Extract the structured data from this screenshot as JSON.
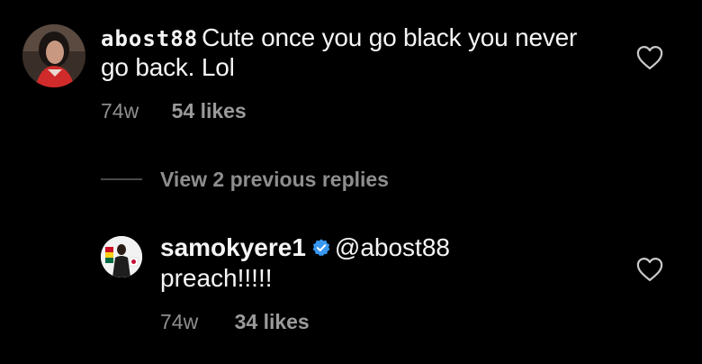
{
  "comment": {
    "username": "abost88",
    "text": "Cute once you go black you never go back. Lol",
    "time": "74w",
    "likes": "54 likes",
    "like_icon": "heart-outline-icon"
  },
  "view_replies": {
    "label": "View 2 previous replies"
  },
  "reply": {
    "username": "samokyere1",
    "verified_icon": "verified-badge-icon",
    "mention": "@abost88",
    "text": "preach!!!!!",
    "time": "74w",
    "likes": "34 likes",
    "like_icon": "heart-outline-icon"
  },
  "colors": {
    "background": "#000000",
    "text": "#f5f5f5",
    "muted": "#8e8e8e",
    "verified_blue": "#3897f0"
  }
}
